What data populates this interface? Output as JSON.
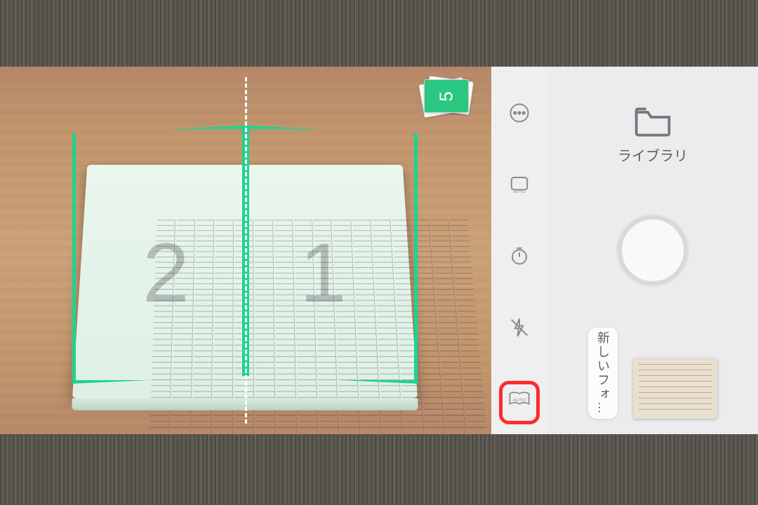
{
  "viewfinder": {
    "page_left_overlay": "2",
    "page_right_overlay": "1",
    "capture_stack_count": "5"
  },
  "toolstrip": {
    "more_name": "more-icon",
    "auto_frame_name": "auto-frame-icon",
    "timer_name": "timer-icon",
    "flash_name": "flash-off-icon",
    "book_auto_name": "book-auto-icon",
    "book_auto_text": "AUTO"
  },
  "panel": {
    "library_label": "ライブラリ",
    "new_folder_label": "新しいフォ…"
  }
}
